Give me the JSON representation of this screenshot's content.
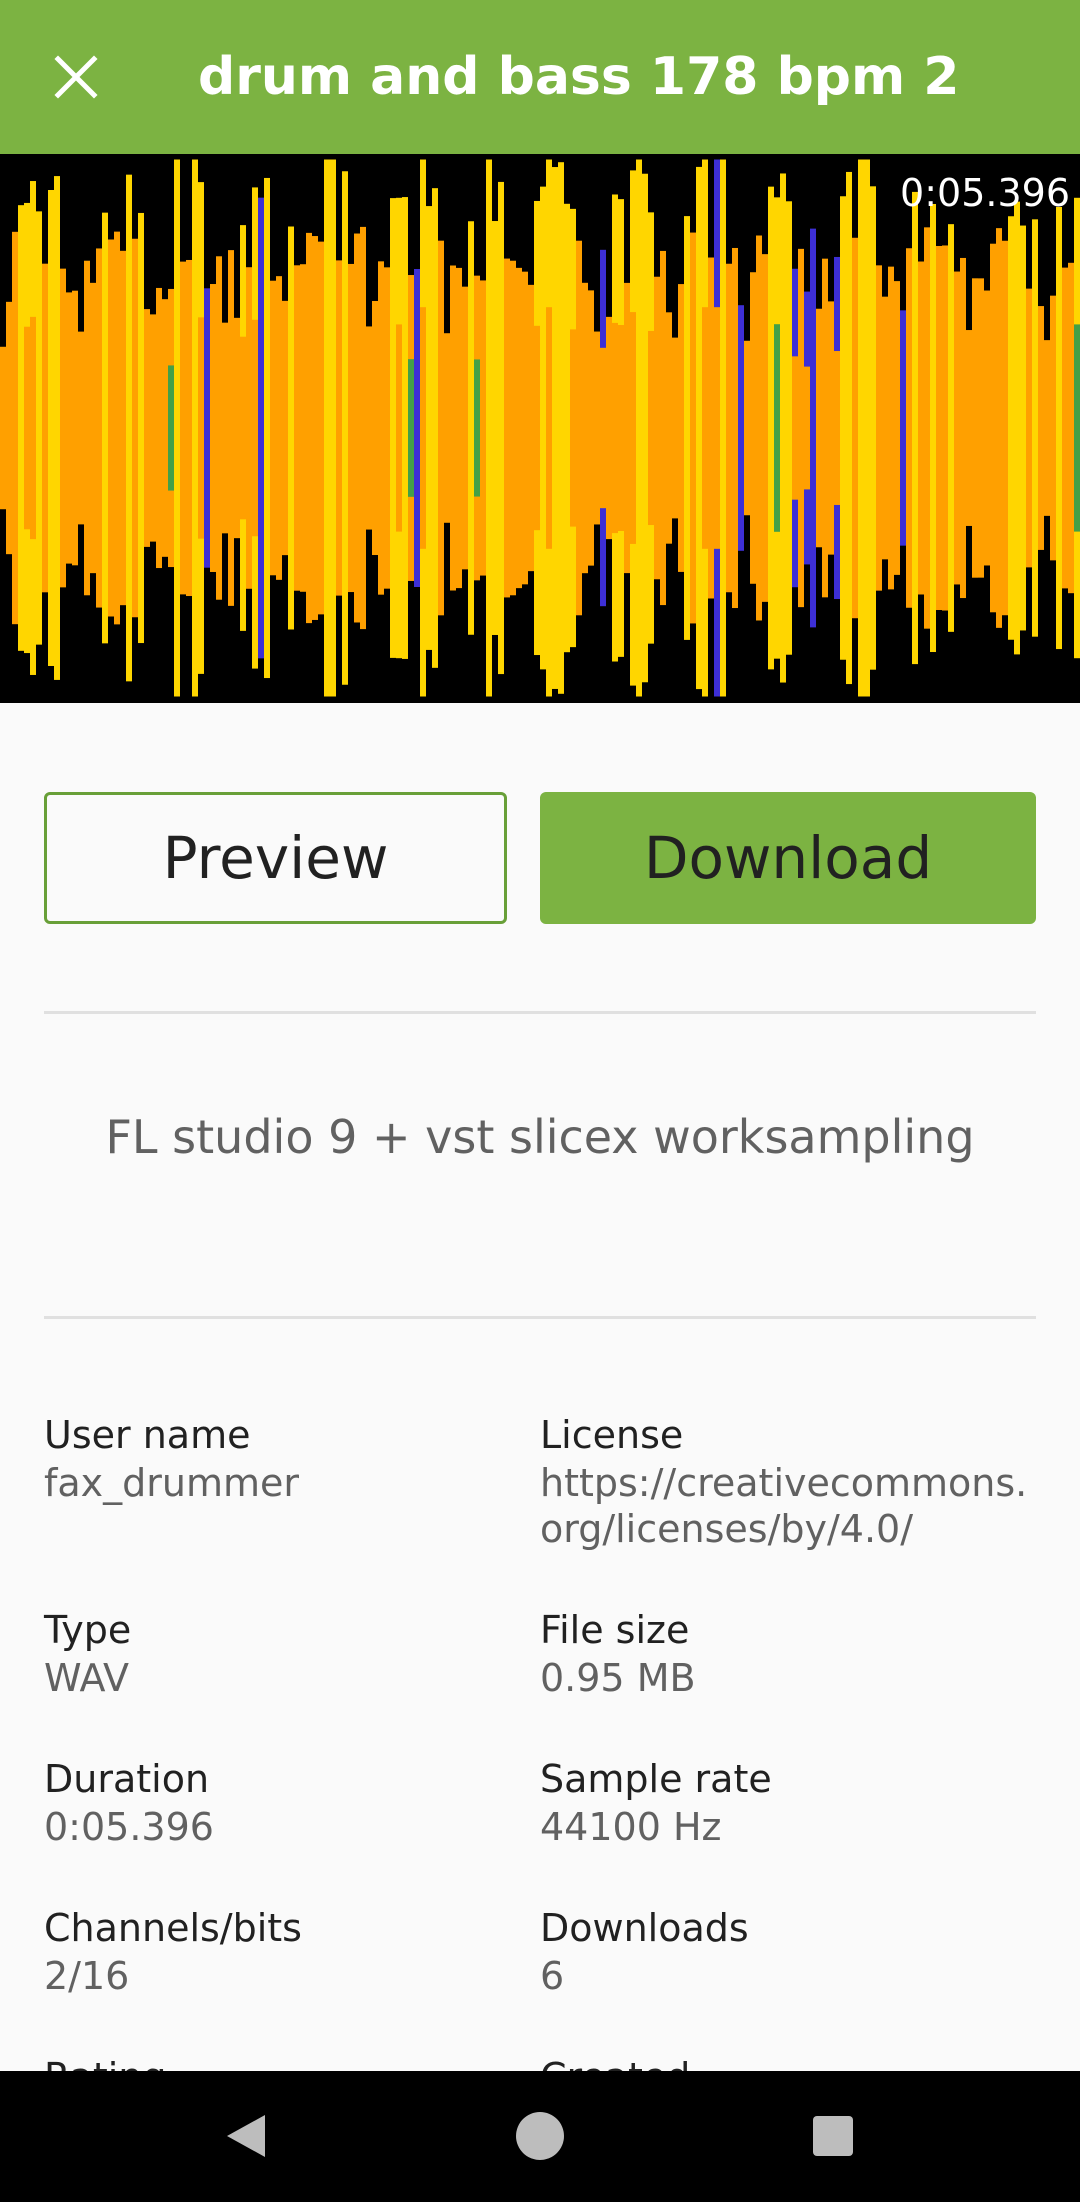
{
  "header": {
    "title": "drum and bass 178 bpm 2",
    "close_icon": "close-icon"
  },
  "waveform": {
    "duration_label": "0:05.396",
    "colors": {
      "background": "#000000",
      "peak": "#ffd600",
      "mid": "#ffa000",
      "low": "#3d2fd6",
      "accent": "#43a047"
    }
  },
  "actions": {
    "preview_label": "Preview",
    "download_label": "Download"
  },
  "description": "FL studio 9 + vst slicex worksampling",
  "details": {
    "user_name": {
      "label": "User name",
      "value": "fax_drummer"
    },
    "license": {
      "label": "License",
      "value": "https://creativecommons.org/licenses/by/4.0/"
    },
    "type": {
      "label": "Type",
      "value": "WAV"
    },
    "file_size": {
      "label": "File size",
      "value": "0.95 MB"
    },
    "duration": {
      "label": "Duration",
      "value": "0:05.396"
    },
    "sample_rate": {
      "label": "Sample rate",
      "value": "44100 Hz"
    },
    "channels_bits": {
      "label": "Channels/bits",
      "value": "2/16"
    },
    "downloads": {
      "label": "Downloads",
      "value": "6"
    },
    "rating": {
      "label": "Rating"
    },
    "created": {
      "label": "Created"
    }
  },
  "theme": {
    "primary": "#7cb342",
    "primary_dark": "#689f38",
    "background": "#fafafa",
    "divider": "#e0e0e0"
  },
  "nav": {
    "back_icon": "back-triangle-icon",
    "home_icon": "home-circle-icon",
    "recents_icon": "recents-square-icon"
  }
}
